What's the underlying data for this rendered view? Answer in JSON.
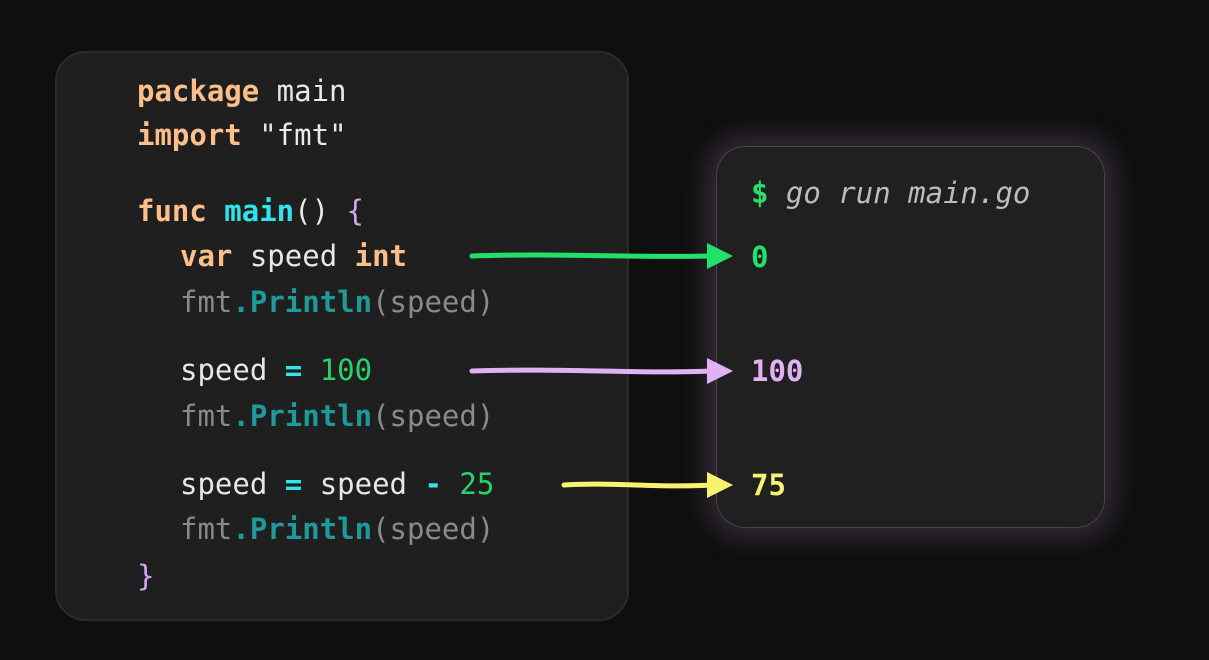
{
  "code": {
    "line1": {
      "kw": "package",
      "rest": " main"
    },
    "line2": {
      "kw": "import",
      "rest": " \"fmt\""
    },
    "line3": {
      "kw": "func",
      "fn": " main",
      "paren": "()",
      "brace": " {"
    },
    "line4": {
      "kw": "var",
      "mid": " speed ",
      "type": "int"
    },
    "print": {
      "pkg": "fmt",
      "dot": ".",
      "method": "Println",
      "args": "(speed)"
    },
    "line6": {
      "lhs": "speed",
      "op": " = ",
      "num": "100"
    },
    "line8": {
      "lhs": "speed",
      "op1": " = ",
      "mid": "speed",
      "op2": " - ",
      "num": "25"
    },
    "close": "}"
  },
  "terminal": {
    "prompt": "$",
    "command": " go run main.go",
    "outputs": [
      "0",
      "100",
      "75"
    ]
  },
  "colors": {
    "arrow1": "#22e06a",
    "arrow2": "#e2b1f5",
    "arrow3": "#f8f36e"
  }
}
